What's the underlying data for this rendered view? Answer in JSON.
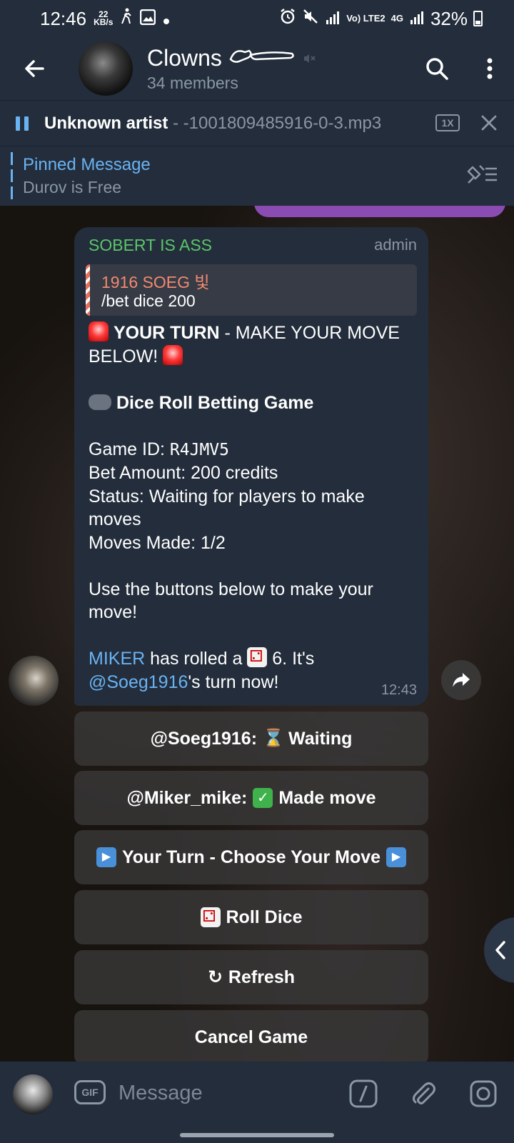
{
  "status_bar": {
    "time": "12:46",
    "speed_value": "22",
    "speed_unit": "KB/s",
    "network": "4G",
    "lte_label": "Vo) LTE2",
    "battery": "32%"
  },
  "header": {
    "title": "Clowns",
    "subtitle": "34 members",
    "icons": [
      "back-arrow-icon",
      "search-icon",
      "more-vertical-icon",
      "muted-icon"
    ]
  },
  "player": {
    "artist": "Unknown artist",
    "separator": " - ",
    "filename": "-1001809485916-0-3.mp3",
    "speed": "1X"
  },
  "pinned": {
    "title": "Pinned Message",
    "text": "Durov is Free"
  },
  "message": {
    "sender": "SOBERT IS ASS",
    "role": "admin",
    "reply_name": "1916 SOEG 빛",
    "reply_text": "/bet dice 200",
    "line_turn_bold": "YOUR TURN",
    "line_turn_rest": " - MAKE YOUR MOVE BELOW!",
    "line_game_title": "Dice Roll Betting Game",
    "game_id_label": "Game ID: ",
    "game_id_value": "R4JMV5",
    "bet_amount": "Bet Amount: 200 credits",
    "status": "Status: Waiting for players to make moves",
    "moves_made": "Moves Made: 1/2",
    "instructions": "Use the buttons below to make your move!",
    "roll_user": "MIKER",
    "roll_text": " has rolled a ",
    "roll_value": " 6. It's ",
    "turn_user": "@Soeg1916",
    "turn_text": "'s turn now!",
    "time": "12:43"
  },
  "buttons": {
    "waiting_user": "@Soeg1916:",
    "waiting_label": "Waiting",
    "made_user": "@Miker_mike:",
    "made_label": "Made move",
    "your_turn": "Your Turn - Choose Your Move",
    "roll_dice": "Roll Dice",
    "refresh_icon": "↻",
    "refresh": "Refresh",
    "cancel": "Cancel Game"
  },
  "input": {
    "gif": "GIF",
    "placeholder": "Message"
  },
  "colors": {
    "bar_bg": "#232d3b",
    "accent_blue": "#6ab3f3",
    "sender_green": "#5cc66a",
    "reply_orange": "#f28a71",
    "own_bubble": "#8a4bb3"
  }
}
